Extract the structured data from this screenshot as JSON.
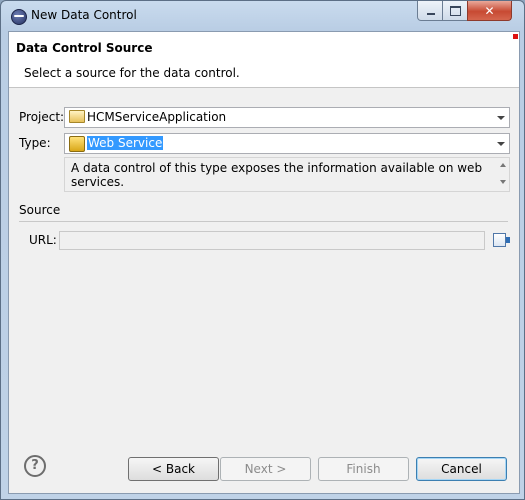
{
  "window": {
    "title": "New Data Control"
  },
  "banner": {
    "title": "Data Control Source",
    "description": "Select a source for the data control."
  },
  "form": {
    "project_label": "Project:",
    "project_value": "HCMServiceApplication",
    "type_label": "Type:",
    "type_value": "Web Service",
    "type_description": "A data control of this type exposes the information available on web services.",
    "source_label": "Source",
    "url_label": "URL:",
    "url_value": ""
  },
  "buttons": {
    "help": "?",
    "back": "< Back",
    "next": "Next >",
    "finish": "Finish",
    "cancel": "Cancel"
  },
  "icons": {
    "app": "eclipse-icon",
    "project": "folder-project-icon",
    "type": "web-service-icon",
    "browse": "browse-icon",
    "help": "help-icon"
  },
  "colors": {
    "selection": "#3399ff",
    "close_button": "#c74a33",
    "banner_marker": "#dd1111"
  }
}
